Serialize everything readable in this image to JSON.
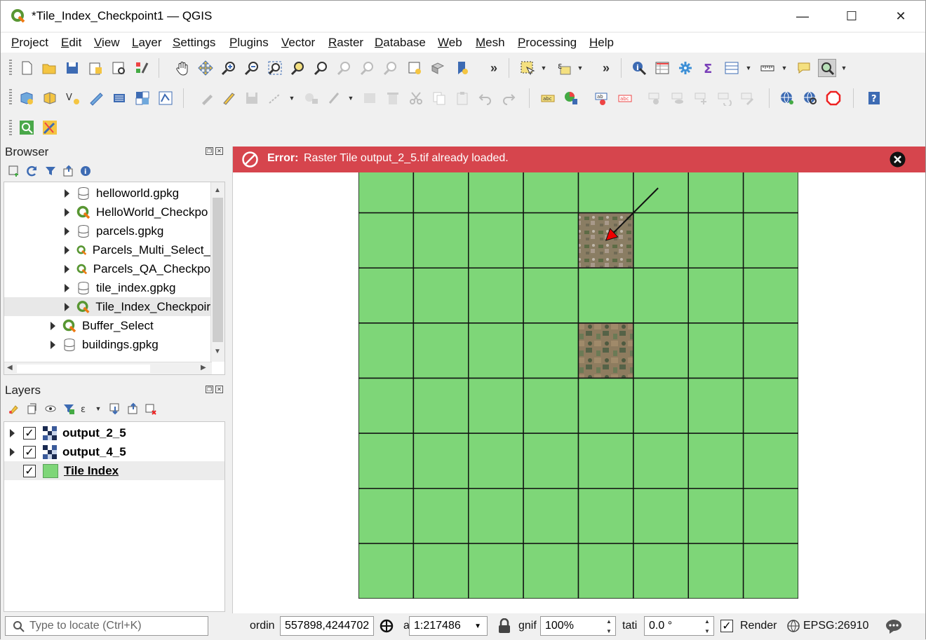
{
  "window": {
    "title": "*Tile_Index_Checkpoint1 — QGIS",
    "controls": {
      "minimize": "—",
      "maximize": "☐",
      "close": "✕"
    }
  },
  "menu": [
    "Project",
    "Edit",
    "View",
    "Layer",
    "Settings",
    "Plugins",
    "Vector",
    "Raster",
    "Database",
    "Web",
    "Mesh",
    "Processing",
    "Help"
  ],
  "toolbar": {
    "overflow": "»"
  },
  "browser": {
    "title": "Browser",
    "items": [
      {
        "label": "helloworld.gpkg",
        "icon": "geopackage-icon"
      },
      {
        "label": "HelloWorld_Checkpo",
        "icon": "qgis-project-icon"
      },
      {
        "label": "parcels.gpkg",
        "icon": "geopackage-icon"
      },
      {
        "label": "Parcels_Multi_Select_",
        "icon": "qgis-project-icon"
      },
      {
        "label": "Parcels_QA_Checkpo",
        "icon": "qgis-project-icon"
      },
      {
        "label": "tile_index.gpkg",
        "icon": "geopackage-icon"
      },
      {
        "label": "Tile_Index_Checkpoir",
        "icon": "qgis-project-icon",
        "selected": true
      },
      {
        "label": "Buffer_Select",
        "icon": "qgis-project-icon"
      },
      {
        "label": "buildings.gpkg",
        "icon": "geopackage-icon"
      }
    ]
  },
  "layers": {
    "title": "Layers",
    "items": [
      {
        "label": "output_2_5",
        "checked": true,
        "type": "raster"
      },
      {
        "label": "output_4_5",
        "checked": true,
        "type": "raster"
      },
      {
        "label": "Tile Index",
        "checked": true,
        "type": "vector",
        "color": "#7ed678",
        "active": true
      }
    ]
  },
  "message": {
    "label": "Error:",
    "text": "Raster Tile output_2_5.tif already loaded.",
    "color": "#d6454d"
  },
  "map": {
    "grid_cols": 8,
    "grid_rows": 8,
    "fill_color": "#7ed678",
    "raster_tiles": [
      {
        "col": 4,
        "row": 1
      },
      {
        "col": 4,
        "row": 3
      }
    ]
  },
  "status": {
    "locate_placeholder": "Type to locate (Ctrl+K)",
    "coord_label": "ordin",
    "coordinate": "557898,4244702",
    "scale_label": "a",
    "scale": "1:217486",
    "magnifier_label": "gnif",
    "magnifier": "100%",
    "rotation_label": "tati",
    "rotation": "0.0 °",
    "render_label": "Render",
    "render_checked": true,
    "crs": "EPSG:26910"
  }
}
